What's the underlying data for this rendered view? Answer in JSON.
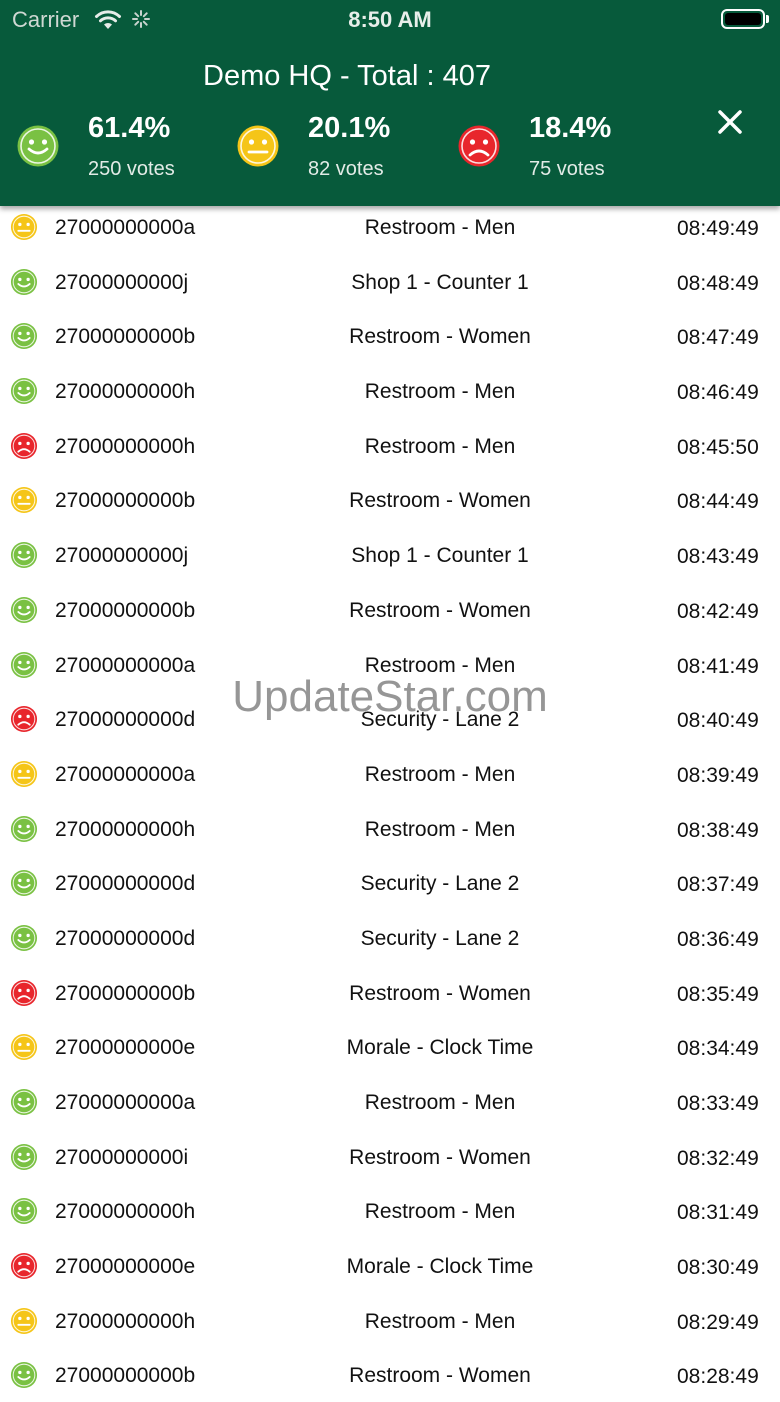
{
  "status_bar": {
    "carrier": "Carrier",
    "time": "8:50 AM"
  },
  "header": {
    "title": "Demo HQ - Total : 407",
    "stats": [
      {
        "percent": "61.4%",
        "votes": "250 votes",
        "mood": "happy",
        "color": "#7ac143"
      },
      {
        "percent": "20.1%",
        "votes": "82 votes",
        "mood": "neutral",
        "color": "#f5c518"
      },
      {
        "percent": "18.4%",
        "votes": "75 votes",
        "mood": "sad",
        "color": "#e8262c"
      }
    ],
    "close_icon": "close-icon"
  },
  "rows": [
    {
      "mood": "neutral",
      "id": "27000000000a",
      "location": "Restroom - Men",
      "time": "08:49:49"
    },
    {
      "mood": "happy",
      "id": "27000000000j",
      "location": "Shop 1 - Counter 1",
      "time": "08:48:49"
    },
    {
      "mood": "happy",
      "id": "27000000000b",
      "location": "Restroom - Women",
      "time": "08:47:49"
    },
    {
      "mood": "happy",
      "id": "27000000000h",
      "location": "Restroom - Men",
      "time": "08:46:49"
    },
    {
      "mood": "sad",
      "id": "27000000000h",
      "location": "Restroom - Men",
      "time": "08:45:50"
    },
    {
      "mood": "neutral",
      "id": "27000000000b",
      "location": "Restroom - Women",
      "time": "08:44:49"
    },
    {
      "mood": "happy",
      "id": "27000000000j",
      "location": "Shop 1 - Counter 1",
      "time": "08:43:49"
    },
    {
      "mood": "happy",
      "id": "27000000000b",
      "location": "Restroom - Women",
      "time": "08:42:49"
    },
    {
      "mood": "happy",
      "id": "27000000000a",
      "location": "Restroom - Men",
      "time": "08:41:49"
    },
    {
      "mood": "sad",
      "id": "27000000000d",
      "location": "Security - Lane 2",
      "time": "08:40:49"
    },
    {
      "mood": "neutral",
      "id": "27000000000a",
      "location": "Restroom - Men",
      "time": "08:39:49"
    },
    {
      "mood": "happy",
      "id": "27000000000h",
      "location": "Restroom - Men",
      "time": "08:38:49"
    },
    {
      "mood": "happy",
      "id": "27000000000d",
      "location": "Security - Lane 2",
      "time": "08:37:49"
    },
    {
      "mood": "happy",
      "id": "27000000000d",
      "location": "Security - Lane 2",
      "time": "08:36:49"
    },
    {
      "mood": "sad",
      "id": "27000000000b",
      "location": "Restroom - Women",
      "time": "08:35:49"
    },
    {
      "mood": "neutral",
      "id": "27000000000e",
      "location": "Morale - Clock Time",
      "time": "08:34:49"
    },
    {
      "mood": "happy",
      "id": "27000000000a",
      "location": "Restroom - Men",
      "time": "08:33:49"
    },
    {
      "mood": "happy",
      "id": "27000000000i",
      "location": "Restroom - Women",
      "time": "08:32:49"
    },
    {
      "mood": "happy",
      "id": "27000000000h",
      "location": "Restroom - Men",
      "time": "08:31:49"
    },
    {
      "mood": "sad",
      "id": "27000000000e",
      "location": "Morale - Clock Time",
      "time": "08:30:49"
    },
    {
      "mood": "neutral",
      "id": "27000000000h",
      "location": "Restroom - Men",
      "time": "08:29:49"
    },
    {
      "mood": "happy",
      "id": "27000000000b",
      "location": "Restroom - Women",
      "time": "08:28:49"
    }
  ],
  "watermark": "UpdateStar.com"
}
